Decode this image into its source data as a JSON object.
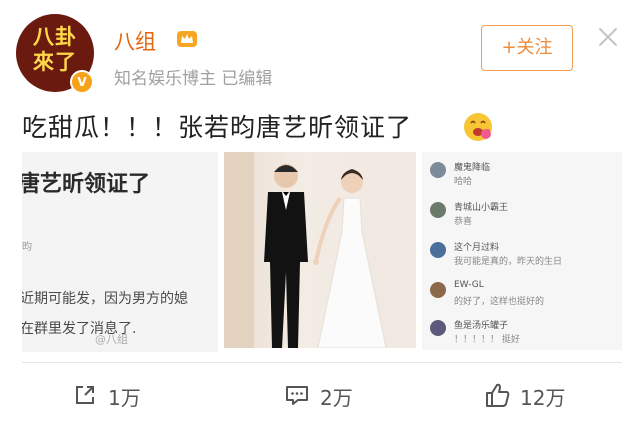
{
  "header": {
    "avatar_text_1": "八卦",
    "avatar_text_2": "來了",
    "username": "八组",
    "subline": "知名娱乐博主 已编辑",
    "follow_label": "+关注"
  },
  "post": {
    "text": "吃甜瓜！！！张若昀唐艺昕领证了"
  },
  "embedded": {
    "title": "唐艺昕领证了",
    "small": "昀",
    "line1": "近期可能发，因为男方的媳",
    "line2": "在群里发了消息了.",
    "watermark": "@八组"
  },
  "comments": [
    {
      "name": "魔鬼降临",
      "body": "哈哈",
      "color": "#7c8a99"
    },
    {
      "name": "青城山小霸王",
      "body": "恭喜",
      "color": "#6b7b6b"
    },
    {
      "name": "这个月过料",
      "body": "我可能是真的，昨天的生日",
      "color": "#4a6f9a"
    },
    {
      "name": "EW-GL",
      "body": "的好了，这样也挺好的",
      "color": "#8a6a4a"
    },
    {
      "name": "鱼是汤乐罐子",
      "body": "！！！！！ 挺好",
      "color": "#5a5a7a"
    }
  ],
  "actions": {
    "share_count": "1万",
    "comment_count": "2万",
    "like_count": "12万"
  },
  "colors": {
    "accent_orange": "#e8640c",
    "follow_border": "#f29b54",
    "avatar_bg": "#6b1a10"
  },
  "icons": [
    "crown-icon",
    "verified-icon",
    "close-icon",
    "emoji-icon",
    "share-icon",
    "comment-icon",
    "like-icon"
  ]
}
